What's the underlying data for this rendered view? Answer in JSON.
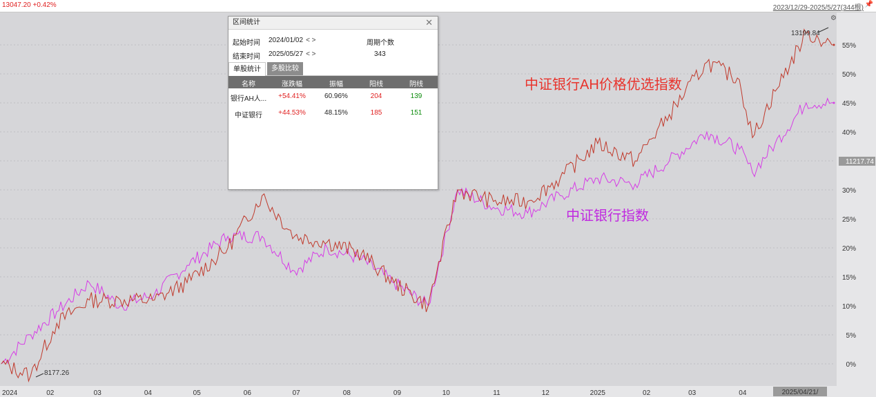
{
  "topbar": {
    "quote": "13047.20 +0.42%",
    "range": "2023/12/29-2025/5/27(344根)"
  },
  "axis": {
    "y_ticks": [
      "55%",
      "50%",
      "45%",
      "40%",
      "35%",
      "30%",
      "25%",
      "20%",
      "15%",
      "10%",
      "5%",
      "0%"
    ],
    "x_ticks": [
      "2024",
      "02",
      "03",
      "04",
      "05",
      "06",
      "07",
      "08",
      "09",
      "10",
      "11",
      "12",
      "2025",
      "02",
      "03",
      "04"
    ],
    "right_marker": "11217.74",
    "bottom_marker": "2025/04/21/",
    "max_label": "13199.84",
    "min_label": "8177.26"
  },
  "labels": {
    "ah": "中证银行AH价格优选指数",
    "bank": "中证银行指数"
  },
  "colors": {
    "ah": "#e8332c",
    "bank": "#c02ae0",
    "ah_line": "#c0392b",
    "bank_line": "#d63ce6"
  },
  "panel": {
    "title": "区间统计",
    "start_label": "起始时间",
    "start_value": "2024/01/02",
    "end_label": "结束时间",
    "end_value": "2025/05/27",
    "arrows": "< >",
    "period_label": "周期个数",
    "period_value": "343",
    "tab_single": "单股统计",
    "tab_multi": "多股比较",
    "headers": [
      "名称",
      "涨跌幅",
      "振幅",
      "阳线",
      "阴线"
    ],
    "rows": [
      {
        "name": "银行AH人...",
        "change": "+54.41%",
        "amp": "60.96%",
        "up": "204",
        "down": "139"
      },
      {
        "name": "中证银行",
        "change": "+44.53%",
        "amp": "48.15%",
        "up": "185",
        "down": "151"
      }
    ]
  },
  "chart_data": {
    "type": "line",
    "title": "",
    "xlabel": "",
    "ylabel": "",
    "ylim": [
      -2,
      58
    ],
    "x": [
      "2024-01-02",
      "2024-01-20",
      "2024-02-05",
      "2024-02-25",
      "2024-03-15",
      "2024-04-05",
      "2024-04-25",
      "2024-05-20",
      "2024-06-10",
      "2024-06-30",
      "2024-07-20",
      "2024-08-10",
      "2024-08-30",
      "2024-09-20",
      "2024-10-08",
      "2024-10-30",
      "2024-11-20",
      "2024-12-10",
      "2025-01-02",
      "2025-01-25",
      "2025-02-15",
      "2025-03-10",
      "2025-03-30",
      "2025-04-07",
      "2025-04-21",
      "2025-05-10",
      "2025-05-27"
    ],
    "series": [
      {
        "name": "中证银行AH价格优选指数",
        "values": [
          0,
          -2,
          7,
          11,
          11,
          11,
          14,
          20,
          29,
          22,
          21,
          19,
          14,
          10,
          30,
          28,
          28,
          32,
          38,
          35,
          43,
          52,
          49,
          39,
          47,
          57,
          55
        ]
      },
      {
        "name": "中证银行指数",
        "values": [
          0,
          5,
          9,
          14,
          10,
          12,
          17,
          22,
          22,
          16,
          20,
          18,
          14,
          10,
          30,
          27,
          26,
          29,
          32,
          31,
          35,
          40,
          37,
          33,
          38,
          45,
          45
        ]
      }
    ]
  }
}
